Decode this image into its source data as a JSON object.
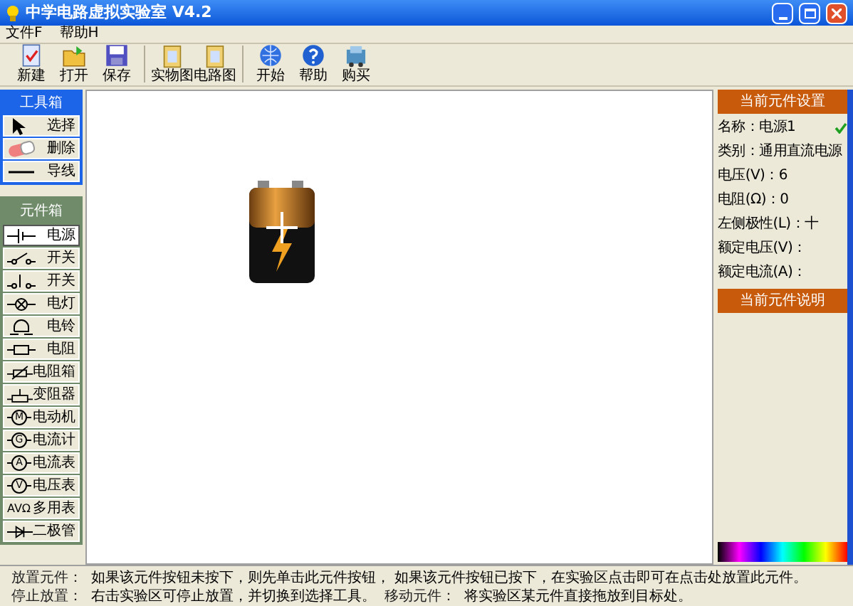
{
  "window": {
    "title": "中学电路虚拟实验室 V4.2"
  },
  "menu": [
    "文件F",
    "帮助H"
  ],
  "toolbar": [
    {
      "label": "新建",
      "kind": "new"
    },
    {
      "label": "打开",
      "kind": "open"
    },
    {
      "label": "保存",
      "kind": "save"
    },
    {
      "label": "实物图",
      "kind": "doc"
    },
    {
      "label": "电路图",
      "kind": "doc"
    },
    {
      "label": "开始",
      "kind": "globe"
    },
    {
      "label": "帮助",
      "kind": "help"
    },
    {
      "label": "购买",
      "kind": "cart"
    }
  ],
  "toolbox": {
    "title": "工具箱",
    "items": [
      {
        "label": "选择",
        "kind": "pointer",
        "selected": false
      },
      {
        "label": "删除",
        "kind": "eraser",
        "selected": false
      },
      {
        "label": "导线",
        "kind": "wire",
        "selected": false
      }
    ]
  },
  "components": {
    "title": "元件箱",
    "items": [
      {
        "label": "电源",
        "kind": "battery",
        "selected": true
      },
      {
        "label": "开关",
        "kind": "switch",
        "selected": false
      },
      {
        "label": "开关",
        "kind": "switch2",
        "selected": false
      },
      {
        "label": "电灯",
        "kind": "lamp",
        "selected": false
      },
      {
        "label": "电铃",
        "kind": "bell",
        "selected": false
      },
      {
        "label": "电阻",
        "kind": "resistor",
        "selected": false
      },
      {
        "label": "电阻箱",
        "kind": "rbox",
        "selected": false
      },
      {
        "label": "变阻器",
        "kind": "rheostat",
        "selected": false
      },
      {
        "label": "电动机",
        "kind": "meter",
        "symbol": "M",
        "selected": false
      },
      {
        "label": "电流计",
        "kind": "meter",
        "symbol": "G",
        "selected": false
      },
      {
        "label": "电流表",
        "kind": "meter",
        "symbol": "A",
        "selected": false
      },
      {
        "label": "电压表",
        "kind": "meter",
        "symbol": "V",
        "selected": false
      },
      {
        "label": "多用表",
        "kind": "multimeter",
        "symbol": "AVΩ",
        "selected": false
      },
      {
        "label": "二极管",
        "kind": "diode",
        "selected": false
      }
    ]
  },
  "settings": {
    "title": "当前元件设置",
    "properties": [
      {
        "text": "名称：电源1",
        "checked": true
      },
      {
        "text": "类别：通用直流电源",
        "checked": false
      },
      {
        "text": "电压(V)：6",
        "checked": false
      },
      {
        "text": "电阻(Ω)：0",
        "checked": false
      },
      {
        "text": "左侧极性(L)：十",
        "checked": false
      },
      {
        "text": "额定电压(V)：",
        "checked": false
      },
      {
        "text": "额定电流(A)：",
        "checked": false
      }
    ]
  },
  "description": {
    "title": "当前元件说明"
  },
  "status_bar": [
    [
      {
        "text": "放置元件：",
        "kind": "label"
      },
      {
        "text": "如果该元件按钮未按下，则先单击此元件按钮， 如果该元件按钮已按下，在实验区点击即可在点击处放置此元件。",
        "kind": "text"
      }
    ],
    [
      {
        "text": "停止放置：",
        "kind": "label"
      },
      {
        "text": "右击实验区可停止放置，并切换到选择工具。",
        "kind": "text"
      },
      {
        "text": "移动元件：",
        "kind": "label"
      },
      {
        "text": "将实验区某元件直接拖放到目标处。",
        "kind": "text"
      }
    ]
  ]
}
